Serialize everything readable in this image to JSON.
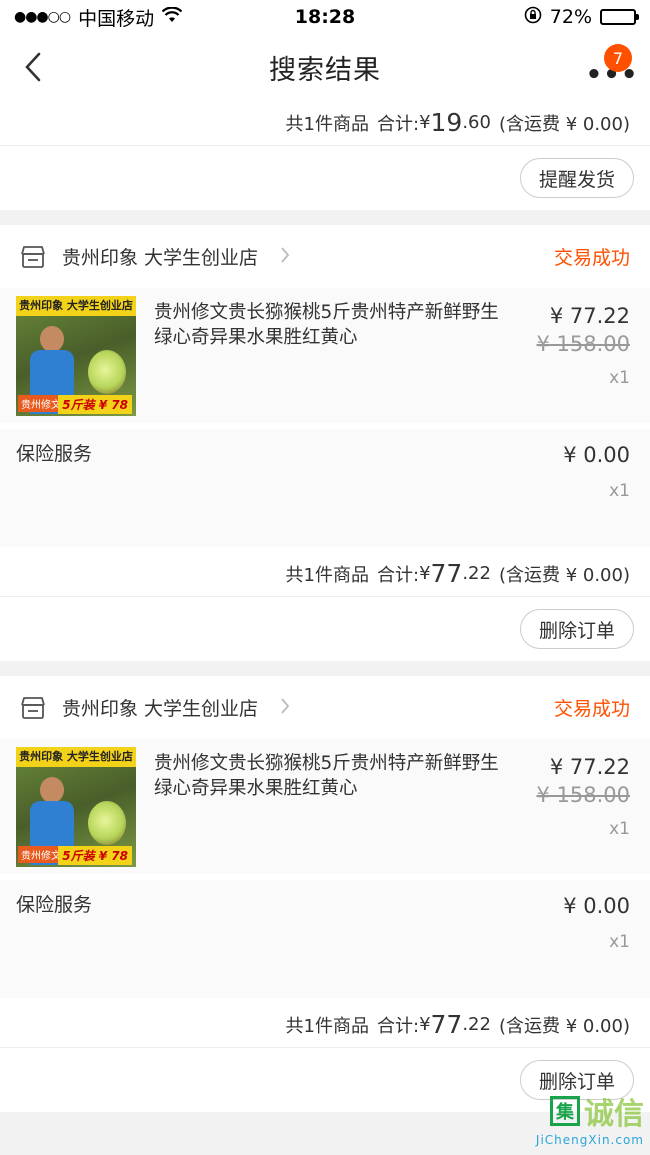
{
  "status_bar": {
    "carrier": "中国移动",
    "time": "18:28",
    "battery": "72%",
    "battery_level": 0.72
  },
  "nav": {
    "title": "搜索结果",
    "badge": "7",
    "more_icon": "more-dots-icon",
    "back_icon": "chevron-left-icon"
  },
  "first_card": {
    "summary": {
      "count_text": "共1件商品",
      "total_label": "合计:",
      "currency": "¥",
      "total_int": "19",
      "total_dec": ".60",
      "shipping": "(含运费 ¥ 0.00)"
    },
    "action_label": "提醒发货"
  },
  "orders": [
    {
      "shop_name": "贵州印象 大学生创业店",
      "status": "交易成功",
      "item": {
        "title": "贵州修文贵长猕猴桃5斤贵州特产新鲜野生绿心奇异果水果胜红黄心",
        "price_now": "¥ 77.22",
        "price_old": "¥ 158.00",
        "qty": "x1",
        "thumb_banner": "贵州印象 大学生创业店",
        "thumb_tag_left": "贵州修文",
        "thumb_tag_right": "5斤装 ¥ 78"
      },
      "insurance": {
        "label": "保险服务",
        "price": "¥ 0.00",
        "qty": "x1"
      },
      "summary": {
        "count_text": "共1件商品",
        "total_label": "合计:",
        "currency": "¥",
        "total_int": "77",
        "total_dec": ".22",
        "shipping": "(含运费 ¥ 0.00)"
      },
      "action_label": "删除订单"
    },
    {
      "shop_name": "贵州印象 大学生创业店",
      "status": "交易成功",
      "item": {
        "title": "贵州修文贵长猕猴桃5斤贵州特产新鲜野生绿心奇异果水果胜红黄心",
        "price_now": "¥ 77.22",
        "price_old": "¥ 158.00",
        "qty": "x1",
        "thumb_banner": "贵州印象 大学生创业店",
        "thumb_tag_left": "贵州修文",
        "thumb_tag_right": "5斤装 ¥ 78"
      },
      "insurance": {
        "label": "保险服务",
        "price": "¥ 0.00",
        "qty": "x1"
      },
      "summary": {
        "count_text": "共1件商品",
        "total_label": "合计:",
        "currency": "¥",
        "total_int": "77",
        "total_dec": ".22",
        "shipping": "(含运费 ¥ 0.00)"
      },
      "action_label": "删除订单"
    }
  ],
  "watermark": {
    "text": "诚信",
    "url": "JiChengXin.com"
  },
  "colors": {
    "accent": "#ff5000",
    "background": "#f2f2f2"
  }
}
